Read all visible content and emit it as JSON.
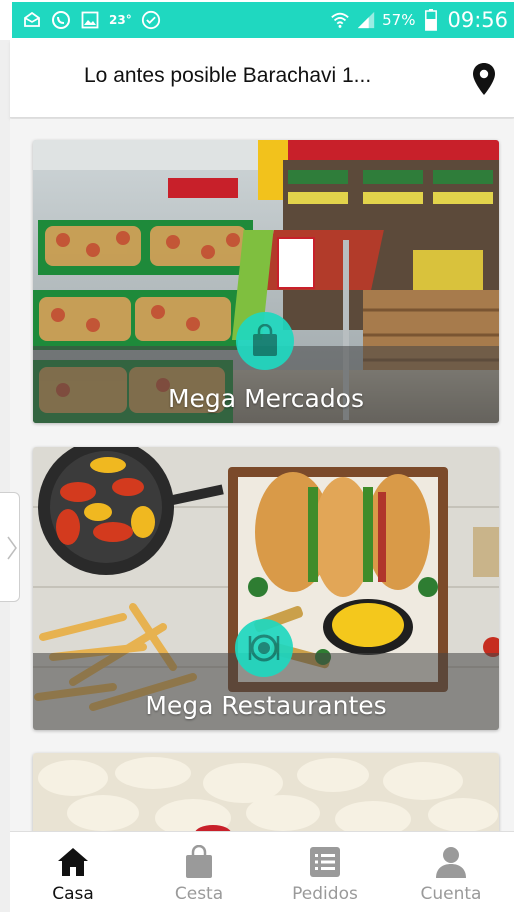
{
  "status_bar": {
    "temperature": "23°",
    "battery": "57%",
    "time": "09:56"
  },
  "header": {
    "title": "Lo antes posible Barachavi 1..."
  },
  "cards": [
    {
      "label": "Mega Mercados",
      "icon": "shopping-bag-icon"
    },
    {
      "label": "Mega Restaurantes",
      "icon": "plate-icon"
    }
  ],
  "bottom_nav": [
    {
      "label": "Casa",
      "icon": "home-icon",
      "active": true
    },
    {
      "label": "Cesta",
      "icon": "basket-icon",
      "active": false
    },
    {
      "label": "Pedidos",
      "icon": "orders-list-icon",
      "active": false
    },
    {
      "label": "Cuenta",
      "icon": "account-icon",
      "active": false
    }
  ],
  "colors": {
    "accent": "#1fd8c0",
    "active_nav": "#111111",
    "inactive_nav": "#9a9a9a"
  }
}
